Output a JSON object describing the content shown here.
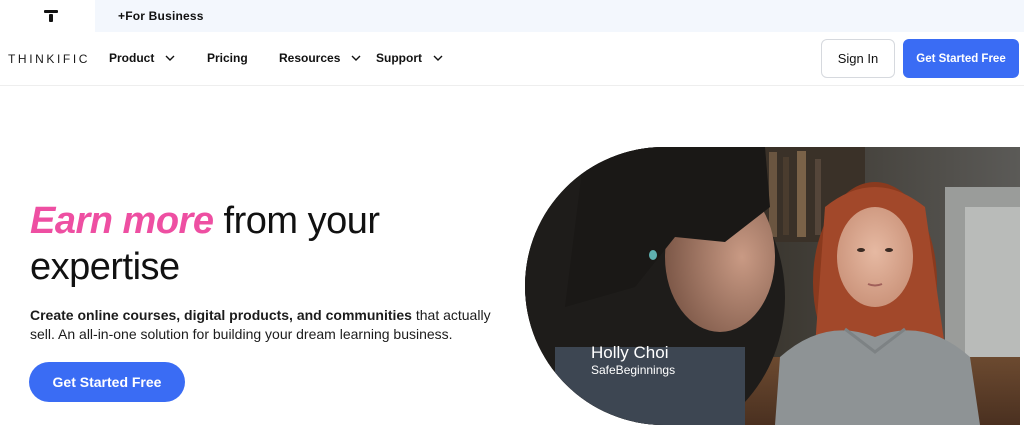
{
  "topbar": {
    "business_link": "+For Business"
  },
  "nav": {
    "logo": "THINKIFIC",
    "items": [
      {
        "label": "Product",
        "has_dropdown": true
      },
      {
        "label": "Pricing",
        "has_dropdown": false
      },
      {
        "label": "Resources",
        "has_dropdown": true
      },
      {
        "label": "Support",
        "has_dropdown": true
      }
    ],
    "sign_in": "Sign In",
    "get_started": "Get Started Free"
  },
  "hero": {
    "title_accent": "Earn more",
    "title_rest_line1": " from your",
    "title_line2": "expertise",
    "desc_bold": "Create online courses, digital products, and communities",
    "desc_rest": " that actually sell. An all-in-one solution for building your dream learning business.",
    "cta": "Get Started Free"
  },
  "video": {
    "person_name": "Holly Choi",
    "person_org": "SafeBeginnings"
  },
  "colors": {
    "accent_pink": "#ee4fa2",
    "primary_blue": "#3a6cf4",
    "topbar_bg": "#f3f7fd"
  },
  "icons": {
    "brand_mark": "thinkific-t-icon",
    "dropdown": "chevron-down-icon"
  }
}
